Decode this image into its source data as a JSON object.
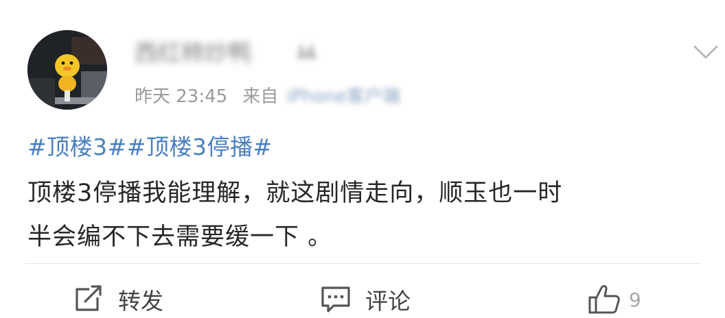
{
  "post": {
    "username": "西红柿炒鸭",
    "time": "昨天 23:45",
    "source_prefix": "来自",
    "source": "iPhone客户端",
    "hashtags": "#顶楼3##顶楼3停播#",
    "text_line1": "顶楼3停播我能理解，就这剧情走向，顺玉也一时",
    "text_line2": "半会编不下去需要缓一下 。"
  },
  "actions": {
    "repost_label": "转发",
    "comment_label": "评论",
    "like_count": "9"
  },
  "icons": {
    "repost": "share-square-icon",
    "comment": "comment-bubble-icon",
    "like": "thumbs-up-icon",
    "menu": "chevron-down-icon"
  },
  "colors": {
    "hashtag": "#4a7fbf",
    "meta": "#9a9a9a",
    "text": "#262626",
    "action": "#444444"
  }
}
